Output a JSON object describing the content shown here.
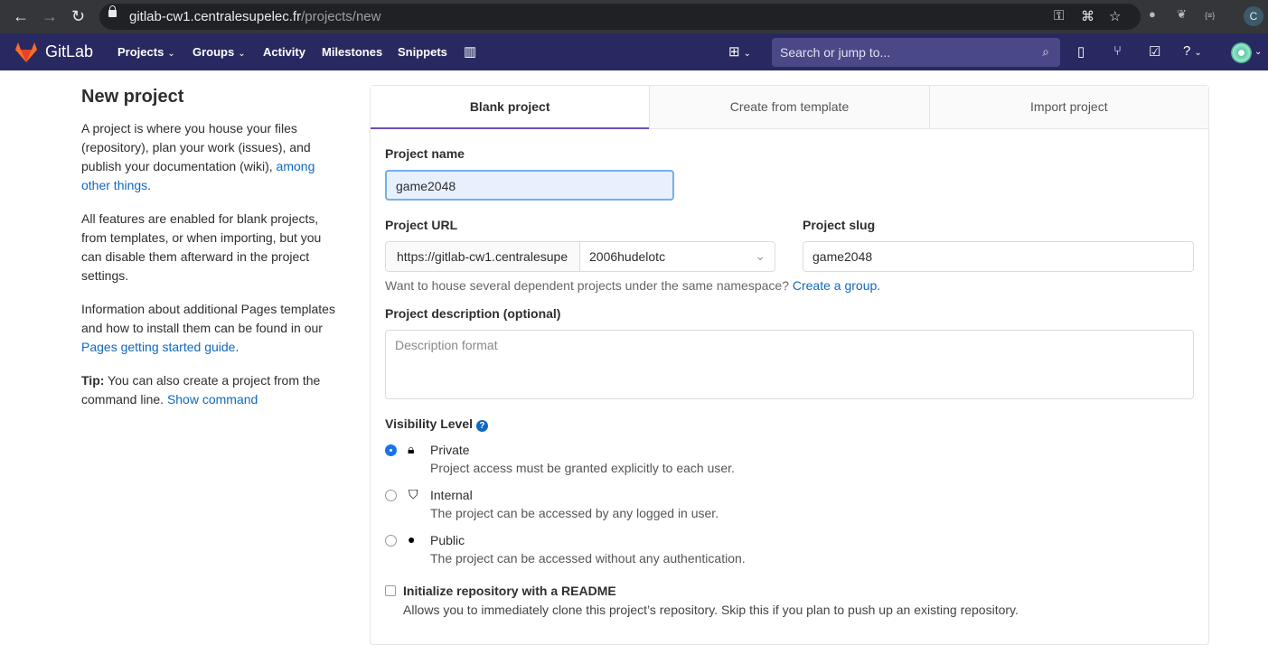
{
  "browser": {
    "url_host": "gitlab-cw1.centralesupelec.fr",
    "url_path": "/projects/new",
    "profile_initial": "C",
    "ext_label": "{≡}"
  },
  "nav": {
    "brand": "GitLab",
    "items": [
      "Projects",
      "Groups",
      "Activity",
      "Milestones",
      "Snippets"
    ],
    "search_placeholder": "Search or jump to..."
  },
  "sidebar": {
    "title": "New project",
    "p1": "A project is where you house your files (repository), plan your work (issues), and publish your documentation (wiki), ",
    "p1_link": "among other things",
    "p1_end": ".",
    "p2": "All features are enabled for blank projects, from templates, or when importing, but you can disable them afterward in the project settings.",
    "p3": "Information about additional Pages templates and how to install them can be found in our ",
    "p3_link": "Pages getting started guide",
    "p3_end": ".",
    "tip_label": "Tip:",
    "tip": " You can also create a project from the command line. ",
    "tip_link": "Show command"
  },
  "tabs": [
    "Blank project",
    "Create from template",
    "Import project"
  ],
  "form": {
    "name_label": "Project name",
    "name_value": "game2048",
    "url_label": "Project URL",
    "url_prefix": "https://gitlab-cw1.centralesupe",
    "namespace": "2006hudelotc",
    "slug_label": "Project slug",
    "slug_value": "game2048",
    "group_help": "Want to house several dependent projects under the same namespace? ",
    "group_link": "Create a group.",
    "desc_label": "Project description (optional)",
    "desc_placeholder": "Description format",
    "visibility_label": "Visibility Level",
    "visibility": [
      {
        "title": "Private",
        "desc": "Project access must be granted explicitly to each user.",
        "selected": true
      },
      {
        "title": "Internal",
        "desc": "The project can be accessed by any logged in user.",
        "selected": false
      },
      {
        "title": "Public",
        "desc": "The project can be accessed without any authentication.",
        "selected": false
      }
    ],
    "readme_label": "Initialize repository with a README",
    "readme_desc": "Allows you to immediately clone this project’s repository. Skip this if you plan to push up an existing repository.",
    "readme_checked": false
  }
}
